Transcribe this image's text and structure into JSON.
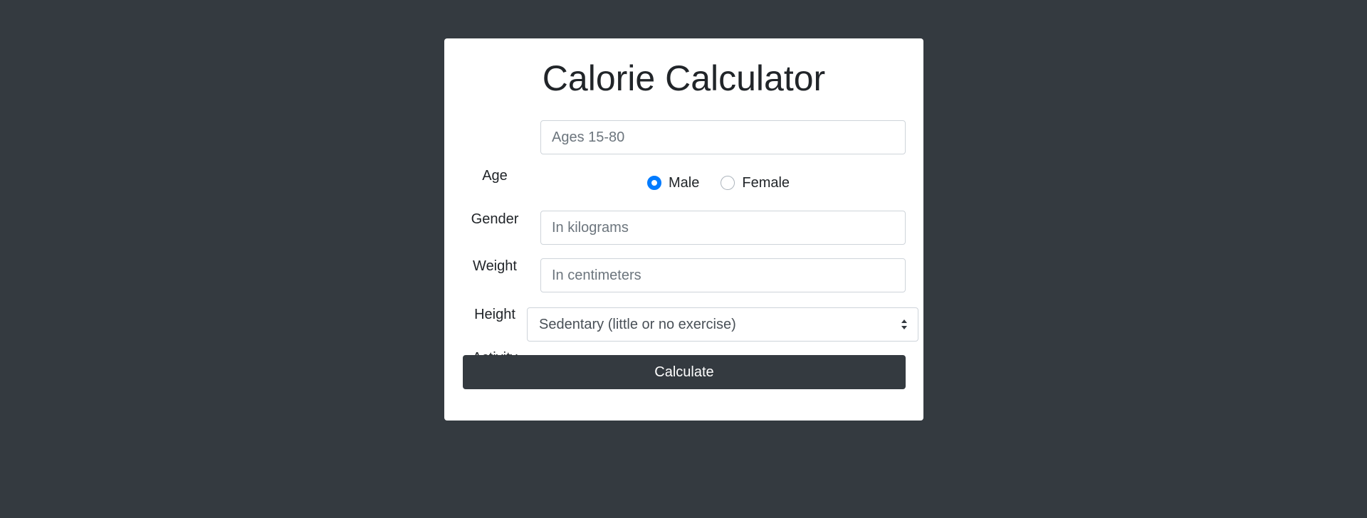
{
  "title": "Calorie Calculator",
  "form": {
    "age": {
      "label": "Age",
      "placeholder": "Ages 15-80",
      "value": ""
    },
    "gender": {
      "label": "Gender",
      "options": [
        {
          "label": "Male",
          "checked": true
        },
        {
          "label": "Female",
          "checked": false
        }
      ]
    },
    "weight": {
      "label": "Weight",
      "placeholder": "In kilograms",
      "value": ""
    },
    "height": {
      "label": "Height",
      "placeholder": "In centimeters",
      "value": ""
    },
    "activity": {
      "label": "Activity",
      "selected": "Sedentary (little or no exercise)"
    },
    "submit_label": "Calculate"
  },
  "colors": {
    "background": "#343a40",
    "card": "#ffffff",
    "accent": "#007bff",
    "button": "#343a40"
  }
}
